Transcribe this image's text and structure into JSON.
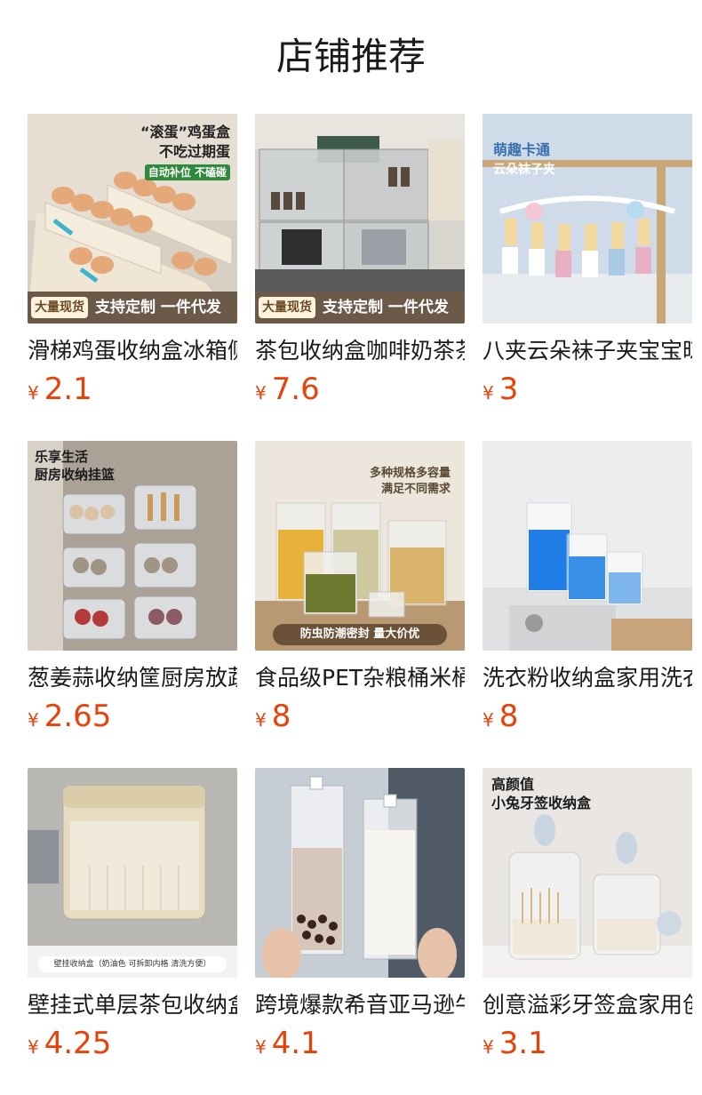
{
  "section": {
    "title": "店铺推荐"
  },
  "products": [
    {
      "title": "滑梯鸡蛋收纳盒冰箱侧",
      "currency": "¥",
      "price": "2.1",
      "overlay": {
        "line1": "“滚蛋”鸡蛋盒",
        "line2": "不吃过期蛋",
        "tag": "自动补位 不磕碰"
      },
      "banner": {
        "tag": "大量现货",
        "text": "支持定制 一件代发"
      }
    },
    {
      "title": "茶包收纳盒咖啡奶茶茶",
      "currency": "¥",
      "price": "7.6",
      "banner": {
        "tag": "大量现货",
        "text": "支持定制 一件代发"
      }
    },
    {
      "title": "八夹云朵袜子夹宝宝晾",
      "currency": "¥",
      "price": "3",
      "overlay": {
        "line1": "萌趣卡通",
        "line2": "云朵袜子夹"
      }
    },
    {
      "title": "葱姜蒜收纳筐厨房放蔬",
      "currency": "¥",
      "price": "2.65",
      "overlay": {
        "line1": "乐享生活",
        "line2": "厨房收纳挂篮"
      }
    },
    {
      "title": "食品级PET杂粮桶米桶",
      "currency": "¥",
      "price": "8",
      "overlay": {
        "line1": "多种规格多容量",
        "line2": "满足不同需求",
        "bottom": "防虫防潮密封 量大价优"
      }
    },
    {
      "title": "洗衣粉收纳盒家用洗衣",
      "currency": "¥",
      "price": "8"
    },
    {
      "title": "壁挂式单层茶包收纳盒",
      "currency": "¥",
      "price": "4.25",
      "overlay": {
        "bottom": "壁挂收纳盒（奶油色 可拆卸内格 清洗方便）"
      }
    },
    {
      "title": "跨境爆款希音亚马逊牛",
      "currency": "¥",
      "price": "4.1"
    },
    {
      "title": "创意溢彩牙签盒家用创",
      "currency": "¥",
      "price": "3.1",
      "overlay": {
        "line1": "高颜值",
        "line2": "小兔牙签收纳盒"
      }
    }
  ],
  "colors": {
    "price": "#e8420a",
    "banner": "#6b5a48",
    "title": "#1a1a1a"
  }
}
